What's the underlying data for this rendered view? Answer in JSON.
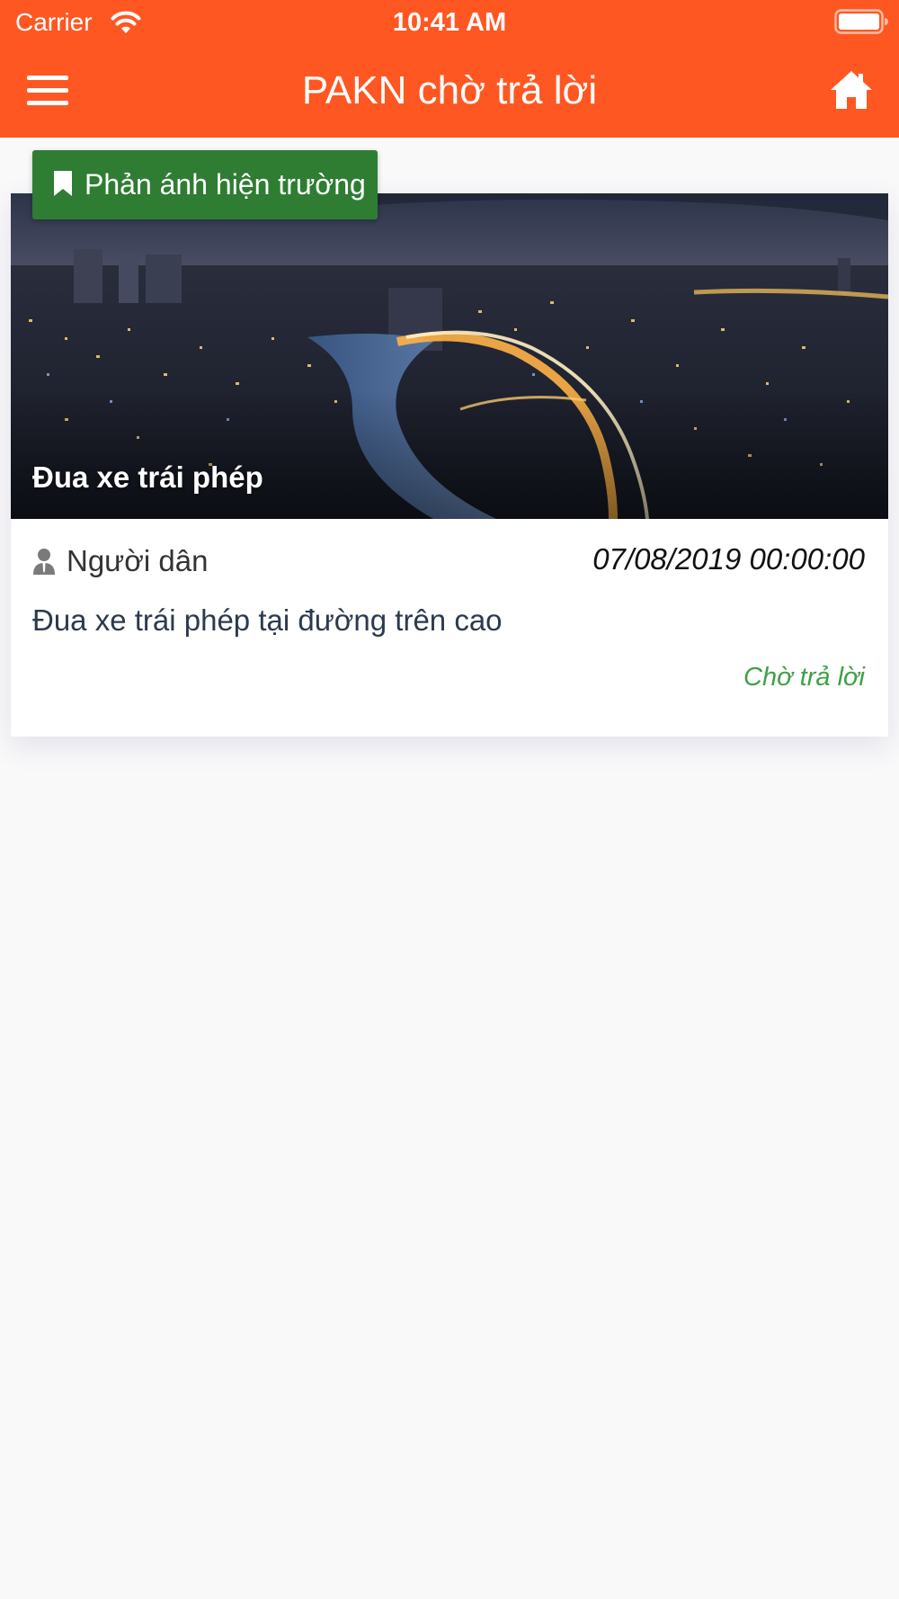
{
  "status_bar": {
    "carrier": "Carrier",
    "time": "10:41 AM"
  },
  "nav_bar": {
    "title": "PAKN chờ trả lời",
    "menu_icon": "hamburger-menu-icon",
    "home_icon": "home-icon"
  },
  "colors": {
    "header": "#ff5722",
    "badge": "#2e7d32",
    "status": "#3fa046",
    "background": "#f9f9fa"
  },
  "feedback_list": {
    "items": [
      {
        "category": "Phản ánh hiện trường",
        "category_icon": "bookmark-icon",
        "image_caption": "Đua xe trái phép",
        "author_icon": "user-icon",
        "author": "Người dân",
        "date": "07/08/2019 00:00:00",
        "content": "Đua xe trái phép tại đường trên cao",
        "status": "Chờ trả lời"
      }
    ]
  }
}
